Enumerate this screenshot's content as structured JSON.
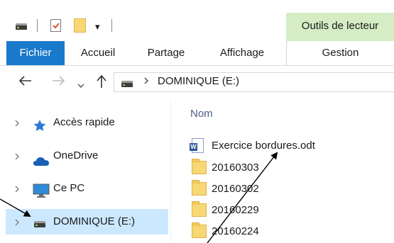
{
  "ribbon": {
    "contextual_group_title": "Outils de lecteur",
    "tabs": [
      "Fichier",
      "Accueil",
      "Partage",
      "Affichage",
      "Gestion"
    ]
  },
  "quick_access": {
    "dropdown_glyph": "▾"
  },
  "address": {
    "path": "DOMINIQUE (E:)"
  },
  "navpane": {
    "items": [
      {
        "label": "Accès rapide",
        "icon": "star-icon"
      },
      {
        "label": "OneDrive",
        "icon": "cloud-icon"
      },
      {
        "label": "Ce PC",
        "icon": "monitor-icon"
      },
      {
        "label": "DOMINIQUE (E:)",
        "icon": "drive-icon",
        "selected": true
      }
    ]
  },
  "content": {
    "column_header": "Nom",
    "files": [
      {
        "name": "Exercice bordures.odt",
        "type": "document"
      },
      {
        "name": "20160303",
        "type": "folder"
      },
      {
        "name": "20160302",
        "type": "folder"
      },
      {
        "name": "20160229",
        "type": "folder"
      },
      {
        "name": "20160224",
        "type": "folder"
      }
    ]
  },
  "colors": {
    "file_tab": "#1979ca",
    "contextual_group": "#d5ecc4",
    "selection": "#cce8ff",
    "folder": "#f8d775"
  }
}
